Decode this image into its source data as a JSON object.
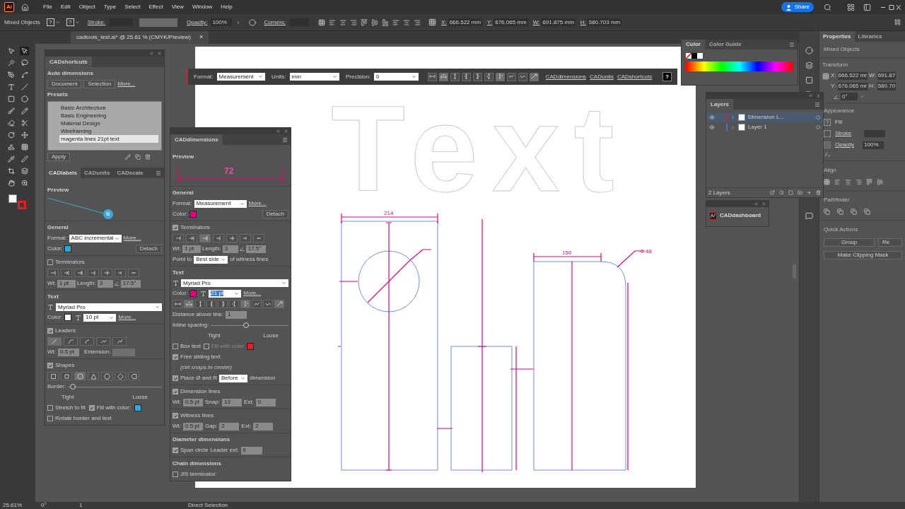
{
  "menu_bar": {
    "logo": "Ai",
    "menus": [
      "File",
      "Edit",
      "Object",
      "Type",
      "Select",
      "Effect",
      "View",
      "Window",
      "Help"
    ],
    "share": "Share"
  },
  "control_bar": {
    "selection": "Mixed Objects",
    "fill_stroke": [
      "?",
      "?"
    ],
    "stroke_label": "Stroke:",
    "opacity_label": "Opacity:",
    "opacity": "100%",
    "corners_label": "Corners:",
    "coords": [
      {
        "label": "X:",
        "value": "666.522 mm"
      },
      {
        "label": "Y:",
        "value": "676.065 mm"
      },
      {
        "label": "W:",
        "value": "691.875 mm"
      },
      {
        "label": "H:",
        "value": "580.703 mm"
      }
    ]
  },
  "document_tab": {
    "title": "cadtools_test.ai* @ 25.61 % (CMYK/Preview)",
    "close": "×"
  },
  "artwork": {
    "outline_text": "Text",
    "labels": [
      "214",
      "150",
      "0.48"
    ]
  },
  "cad_toolbar": {
    "format_label": "Format:",
    "format": "Measurement",
    "units_label": "Units:",
    "units": "mm",
    "precision_label": "Precision:",
    "precision": "0",
    "buttons": [
      {
        "selected": false
      },
      {
        "selected": true
      },
      {
        "selected": false
      },
      {
        "selected": false
      },
      {
        "selected": false
      },
      {
        "selected": false
      },
      {
        "selected": true
      },
      {
        "selected": false
      },
      {
        "selected": false
      },
      {
        "selected": true
      }
    ],
    "links": [
      "CADdimensions",
      "CADunits",
      "CADshortcuts"
    ],
    "help": "?"
  },
  "cadshortcuts": {
    "tab": "CADshortcuts",
    "auto_heading": "Auto dimensions",
    "buttons": [
      "Document",
      "Selection"
    ],
    "more": "More...",
    "presets_heading": "Presets",
    "presets": [
      {
        "label": "Basic Architecture",
        "selected": false
      },
      {
        "label": "Basic Engineering",
        "selected": false
      },
      {
        "label": "Material Design",
        "selected": false
      },
      {
        "label": "Wireframing",
        "selected": false
      },
      {
        "label": "magenta lines 21pt text",
        "selected": true
      }
    ],
    "apply": "Apply"
  },
  "cadlabels": {
    "tabs": [
      {
        "label": "CADlabels",
        "selected": true
      },
      {
        "label": "CADunits",
        "selected": false
      },
      {
        "label": "CADscale",
        "selected": false
      }
    ],
    "preview_heading": "Preview",
    "preview_label": "B",
    "general_heading": "General",
    "format_label": "Format:",
    "format": "ABC incremental",
    "more": "More...",
    "color_label": "Color:",
    "color": "#29abe2",
    "detach": "Detach",
    "terminators": {
      "label": "Terminators",
      "checked": false,
      "buttons": [
        {
          "selected": false
        },
        {
          "selected": false
        },
        {
          "selected": false
        },
        {
          "selected": false
        },
        {
          "selected": false
        },
        {
          "selected": false
        },
        {
          "selected": false
        }
      ],
      "wt_label": "Wt:",
      "wt": "1 pt",
      "length_label": "Length:",
      "length": "3",
      "angle": "17.5°"
    },
    "text": {
      "heading": "Text",
      "font": "Myriad Pro",
      "color_label": "Color:",
      "color": "#ffffff",
      "size": "10 pt",
      "more": "More..."
    },
    "leaders": {
      "label": "Leaders",
      "checked": true,
      "buttons": [
        {
          "selected": true
        },
        {
          "selected": false
        },
        {
          "selected": false
        },
        {
          "selected": false
        },
        {
          "selected": false
        }
      ],
      "wt_label": "Wt:",
      "wt": "0.5 pt",
      "extension_label": "Extension:"
    },
    "shapes": {
      "label": "Shapes",
      "checked": true,
      "buttons": [
        {
          "selected": false
        },
        {
          "selected": false
        },
        {
          "selected": true
        },
        {
          "selected": false
        },
        {
          "selected": false
        },
        {
          "selected": false
        },
        {
          "selected": false
        }
      ],
      "border_label": "Border:",
      "border": {
        "level": 0.05
      },
      "tight": "Tight",
      "loose": "Loose",
      "stretch": {
        "label": "Stretch to fit",
        "checked": false
      },
      "fill": {
        "label": "Fill with color:",
        "checked": true,
        "color": "#29abe2"
      },
      "rotate": {
        "label": "Rotate border and text",
        "checked": false
      }
    }
  },
  "caddimensions": {
    "title": "CADdimensions",
    "preview_heading": "Preview",
    "preview_value": "72",
    "general_heading": "General",
    "format_label": "Format:",
    "format": "Measurement",
    "more": "More...",
    "color_label": "Color:",
    "color": "#e6007e",
    "detach": "Detach",
    "terminators": {
      "label": "Terminators",
      "checked": true,
      "buttons": [
        {
          "selected": false
        },
        {
          "selected": false
        },
        {
          "selected": true
        },
        {
          "selected": false
        },
        {
          "selected": false
        },
        {
          "selected": false
        },
        {
          "selected": false
        }
      ],
      "wt_label": "Wt:",
      "wt": "1 pt",
      "length_label": "Length:",
      "length": "3",
      "angle": "17.5°",
      "point_label": "Point to",
      "point": "Best side",
      "point_suffix": "of witness lines"
    },
    "text": {
      "heading": "Text",
      "font": "Myriad Pro",
      "color_label": "Color:",
      "color": "#e6007e",
      "size": "21 pt",
      "more": "More...",
      "buttons": [
        {
          "selected": false
        },
        {
          "selected": true
        },
        {
          "selected": false
        },
        {
          "selected": false
        },
        {
          "selected": false
        },
        {
          "selected": false
        },
        {
          "selected": true
        },
        {
          "selected": false
        },
        {
          "selected": false
        },
        {
          "selected": true
        }
      ],
      "distance_label": "Distance above line:",
      "distance": "1",
      "spacing": {
        "label": "Inline spacing:",
        "level": 0.45
      },
      "tight": "Tight",
      "loose": "Loose",
      "box_text": {
        "label": "Box text",
        "checked": false
      },
      "box_fill": {
        "label": "Fill with color",
        "checked": false,
        "disabled": true,
        "color": "#e31e24"
      },
      "sliding": {
        "label": "Free sliding text",
        "checked": true
      },
      "sliding_note": "(ctrl snaps to center)",
      "place": {
        "label": "Place Ø and R",
        "checked": true
      },
      "place_value": "Before",
      "place_suffix": "dimension"
    },
    "dimension_lines": {
      "label": "Dimension lines",
      "checked": true,
      "fields": [
        {
          "label": "Wt:",
          "value": "0.5 pt"
        },
        {
          "label": "Snap:",
          "value": "13"
        },
        {
          "label": "Ext:",
          "value": "0"
        }
      ]
    },
    "witness_lines": {
      "label": "Witness lines",
      "checked": true,
      "fields": [
        {
          "label": "Wt:",
          "value": "0.5 pt"
        },
        {
          "label": "Gap:",
          "value": "2"
        },
        {
          "label": "Ext:",
          "value": "2"
        }
      ]
    },
    "diameter": {
      "heading": "Diameter dimensions",
      "span": {
        "label": "Span circle",
        "checked": true
      },
      "leader_label": "Leader ext:",
      "leader": "6"
    },
    "chain": {
      "heading": "Chain dimensions",
      "jis": {
        "label": "JIS terminator",
        "checked": false
      }
    }
  },
  "color_panel": {
    "tabs": [
      {
        "label": "Color",
        "selected": true
      },
      {
        "label": "Color Guide",
        "selected": false
      }
    ]
  },
  "layers": {
    "title": "Layers",
    "items": [
      {
        "name": "Dimension L...",
        "color": "#c1272d",
        "selected": true
      },
      {
        "name": "Layer 1",
        "color": "#4a6fd0",
        "selected": false
      }
    ],
    "count": "2 Layers"
  },
  "dashboard": {
    "title": "CADdashboard"
  },
  "properties": {
    "tabs": [
      {
        "label": "Properties",
        "selected": true
      },
      {
        "label": "Libraries",
        "selected": false
      }
    ],
    "selection": "Mixed Objects",
    "transform_heading": "Transform",
    "fields": [
      {
        "label": "X:",
        "value": "666.522 mr"
      },
      {
        "label": "W:",
        "value": "691.87"
      },
      {
        "label": "Y:",
        "value": "676.065 mr"
      },
      {
        "label": "H:",
        "value": "580.70"
      }
    ],
    "angle": "0°",
    "appearance_heading": "Appearance",
    "fill_swatch": "?",
    "fill_label": "Fill",
    "stroke_label": "Stroke",
    "opacity_label": "Opacity",
    "opacity": "100%",
    "align_heading": "Align",
    "pathfinder_heading": "Pathfinder",
    "quick_actions_heading": "Quick Actions",
    "actions": [
      "Group",
      "Re"
    ],
    "clipping": "Make Clipping Mask"
  },
  "status_bar": {
    "zoom": "25.61%",
    "angle": "0°",
    "artboard": "1",
    "tool": "Direct Selection"
  }
}
